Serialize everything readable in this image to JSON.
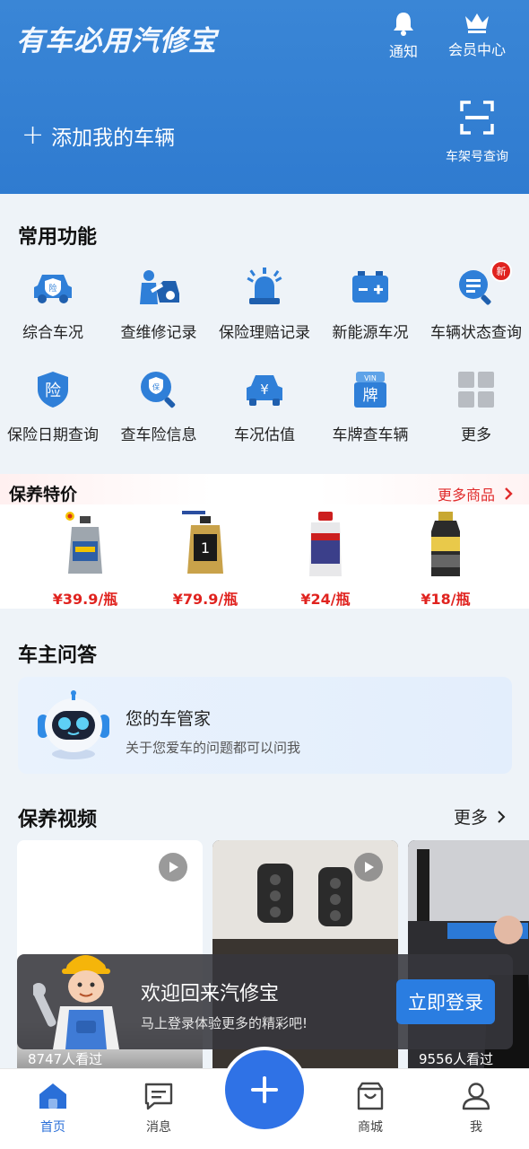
{
  "header": {
    "app_title": "有车必用汽修宝",
    "notify_label": "通知",
    "member_label": "会员中心",
    "add_vehicle_label": "添加我的车辆",
    "vin_query_label": "车架号查询"
  },
  "common": {
    "title": "常用功能",
    "items": [
      {
        "label": "综合车况",
        "icon": "car-shield-icon"
      },
      {
        "label": "查维修记录",
        "icon": "mechanic-icon"
      },
      {
        "label": "保险理赔记录",
        "icon": "alarm-light-icon"
      },
      {
        "label": "新能源车况",
        "icon": "battery-icon"
      },
      {
        "label": "车辆状态查询",
        "icon": "search-doc-icon",
        "badge": "新"
      },
      {
        "label": "保险日期查询",
        "icon": "insurance-shield-icon"
      },
      {
        "label": "查车险信息",
        "icon": "insurance-search-icon"
      },
      {
        "label": "车况估值",
        "icon": "car-price-icon"
      },
      {
        "label": "车牌查车辆",
        "icon": "plate-vin-icon"
      },
      {
        "label": "更多",
        "icon": "grid-more-icon"
      }
    ]
  },
  "specials": {
    "title": "保养特价",
    "more_label": "更多商品",
    "products": [
      {
        "price": "¥39.9/瓶"
      },
      {
        "price": "¥79.9/瓶"
      },
      {
        "price": "¥24/瓶"
      },
      {
        "price": "¥18/瓶"
      }
    ]
  },
  "qa": {
    "title": "车主问答",
    "card_title": "您的车管家",
    "card_subtitle": "关于您爱车的问题都可以问我"
  },
  "videos": {
    "title": "保养视频",
    "more_label": "更多",
    "items": [
      {
        "views": "8747人看过"
      },
      {
        "views": ""
      },
      {
        "views": "9556人看过"
      }
    ]
  },
  "login_toast": {
    "title": "欢迎回来汽修宝",
    "subtitle": "马上登录体验更多的精彩吧!",
    "button": "立即登录"
  },
  "nav": {
    "home": "首页",
    "messages": "消息",
    "mall": "商城",
    "me": "我"
  },
  "colors": {
    "header_blue": "#3a86d6",
    "accent_blue": "#2f72e6",
    "price_red": "#e0231f",
    "icon_blue": "#2f7fd8"
  }
}
